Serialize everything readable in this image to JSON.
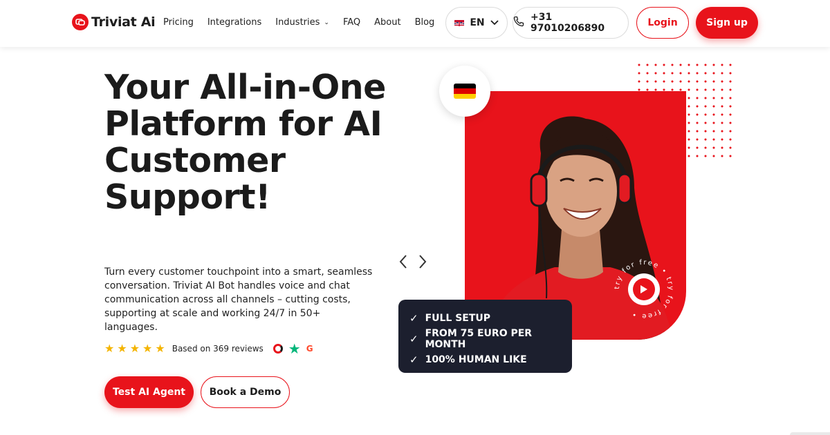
{
  "header": {
    "brand": "Triviat Ai",
    "nav": [
      {
        "label": "Pricing"
      },
      {
        "label": "Integrations"
      },
      {
        "label": "Industries",
        "has_dropdown": true
      },
      {
        "label": "FAQ"
      },
      {
        "label": "About"
      },
      {
        "label": "Blog"
      }
    ],
    "language": "EN",
    "phone": "+31 97010206890",
    "login_label": "Login",
    "signup_label": "Sign up"
  },
  "hero": {
    "title": "Your All-in-One Platform for AI Customer Support!",
    "description": "Turn every customer touchpoint into a smart, seamless conversation. Triviat AI Bot handles voice and chat communication across all channels – cutting costs, supporting at scale and working 24/7 in 50+ languages.",
    "rating": {
      "stars": 5,
      "text": "Based on 369 reviews",
      "review_sites": [
        "capterra-icon",
        "trustpilot-icon",
        "g2-icon"
      ]
    },
    "primary_cta": "Test AI Agent",
    "secondary_cta": "Book a Demo"
  },
  "visual": {
    "language_flag": "germany-flag-icon",
    "play_badge_text": "try for free • try for free •",
    "features": [
      "FULL SETUP",
      "FROM 75 EURO PER MONTH",
      "100% HUMAN LIKE"
    ]
  },
  "colors": {
    "accent": "#e8131b",
    "dark_card": "#1c1f2e",
    "star": "#f4b400"
  }
}
